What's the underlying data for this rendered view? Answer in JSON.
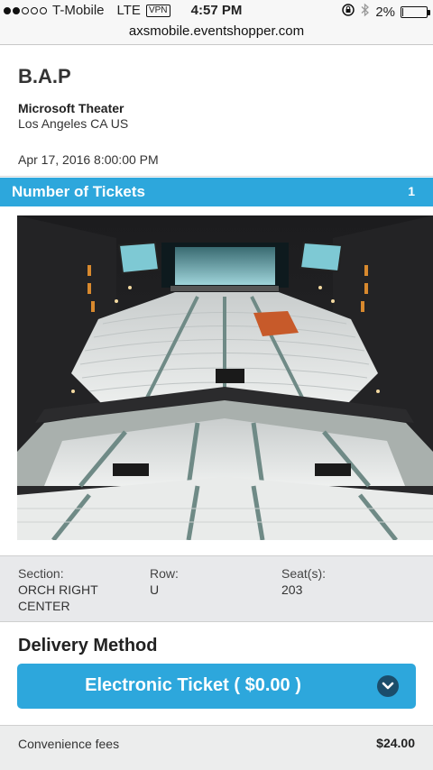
{
  "status_bar": {
    "carrier": "T-Mobile",
    "network": "LTE",
    "vpn": "VPN",
    "time": "4:57 PM",
    "battery": "2%",
    "battery_level": 0.02,
    "signal_bars_on": 2,
    "signal_bars_total": 5
  },
  "browser": {
    "url": "axsmobile.eventshopper.com"
  },
  "event": {
    "title": "B.A.P",
    "venue": "Microsoft Theater",
    "location": "Los Angeles CA US",
    "datetime": "Apr 17, 2016 8:00:00 PM"
  },
  "tickets": {
    "label": "Number of Tickets",
    "count": "1"
  },
  "seat": {
    "section_label": "Section:",
    "section_value": "ORCH RIGHT CENTER",
    "row_label": "Row:",
    "row_value": "U",
    "seats_label": "Seat(s):",
    "seats_value": "203"
  },
  "delivery": {
    "title": "Delivery Method",
    "selected": "Electronic Ticket ( $0.00 )"
  },
  "fees": {
    "label": "Convenience fees",
    "amount": "$24.00"
  },
  "colors": {
    "accent": "#2da7dc",
    "chevron_bg": "#1b4d6b",
    "selected_section": "#c75a2a"
  },
  "icons": [
    "rotation-lock-icon",
    "bluetooth-icon",
    "battery-icon",
    "chevron-down-icon"
  ]
}
